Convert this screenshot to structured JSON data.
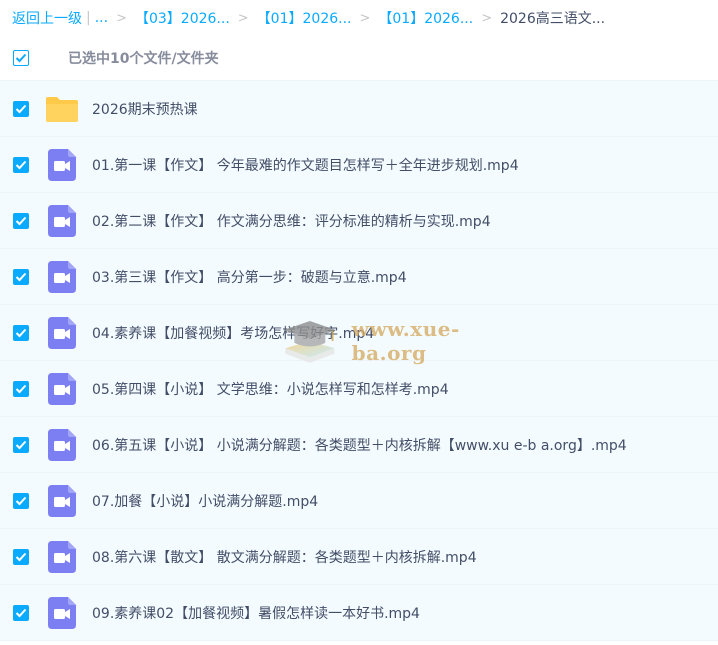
{
  "breadcrumb": {
    "back_label": "返回上一级",
    "ellipsis": "...",
    "crumbs": [
      "【03】2026...",
      "【01】2026...",
      "【01】2026..."
    ],
    "current": "2026高三语文..."
  },
  "select_all": {
    "label": "已选中10个文件/文件夹",
    "checked": true
  },
  "files": [
    {
      "name": "2026期末预热课",
      "type": "folder",
      "icon": "folder-icon"
    },
    {
      "name": "01.第一课【作文】 今年最难的作文题目怎样写＋全年进步规划.mp4",
      "type": "video",
      "icon": "video-file-icon"
    },
    {
      "name": "02.第二课【作文】 作文满分思维：评分标准的精析与实现.mp4",
      "type": "video",
      "icon": "video-file-icon"
    },
    {
      "name": "03.第三课【作文】 高分第一步：破题与立意.mp4",
      "type": "video",
      "icon": "video-file-icon"
    },
    {
      "name": "04.素养课【加餐视频】考场怎样写好字.mp4",
      "type": "video",
      "icon": "video-file-icon"
    },
    {
      "name": "05.第四课【小说】 文学思维：小说怎样写和怎样考.mp4",
      "type": "video",
      "icon": "video-file-icon"
    },
    {
      "name": "06.第五课【小说】 小说满分解题：各类题型＋内核拆解【www.xu e-b a.org】.mp4",
      "type": "video",
      "icon": "video-file-icon"
    },
    {
      "name": "07.加餐【小说】小说满分解题.mp4",
      "type": "video",
      "icon": "video-file-icon"
    },
    {
      "name": "08.第六课【散文】 散文满分解题：各类题型＋内核拆解.mp4",
      "type": "video",
      "icon": "video-file-icon"
    },
    {
      "name": "09.素养课02【加餐视频】暑假怎样读一本好书.mp4",
      "type": "video",
      "icon": "video-file-icon"
    }
  ],
  "watermark": {
    "text": "www.xue-ba.org"
  },
  "colors": {
    "accent": "#09aaff",
    "video_icon": "#7b7ff2",
    "folder": "#ffc94a",
    "row_bg": "#f4fbff"
  }
}
